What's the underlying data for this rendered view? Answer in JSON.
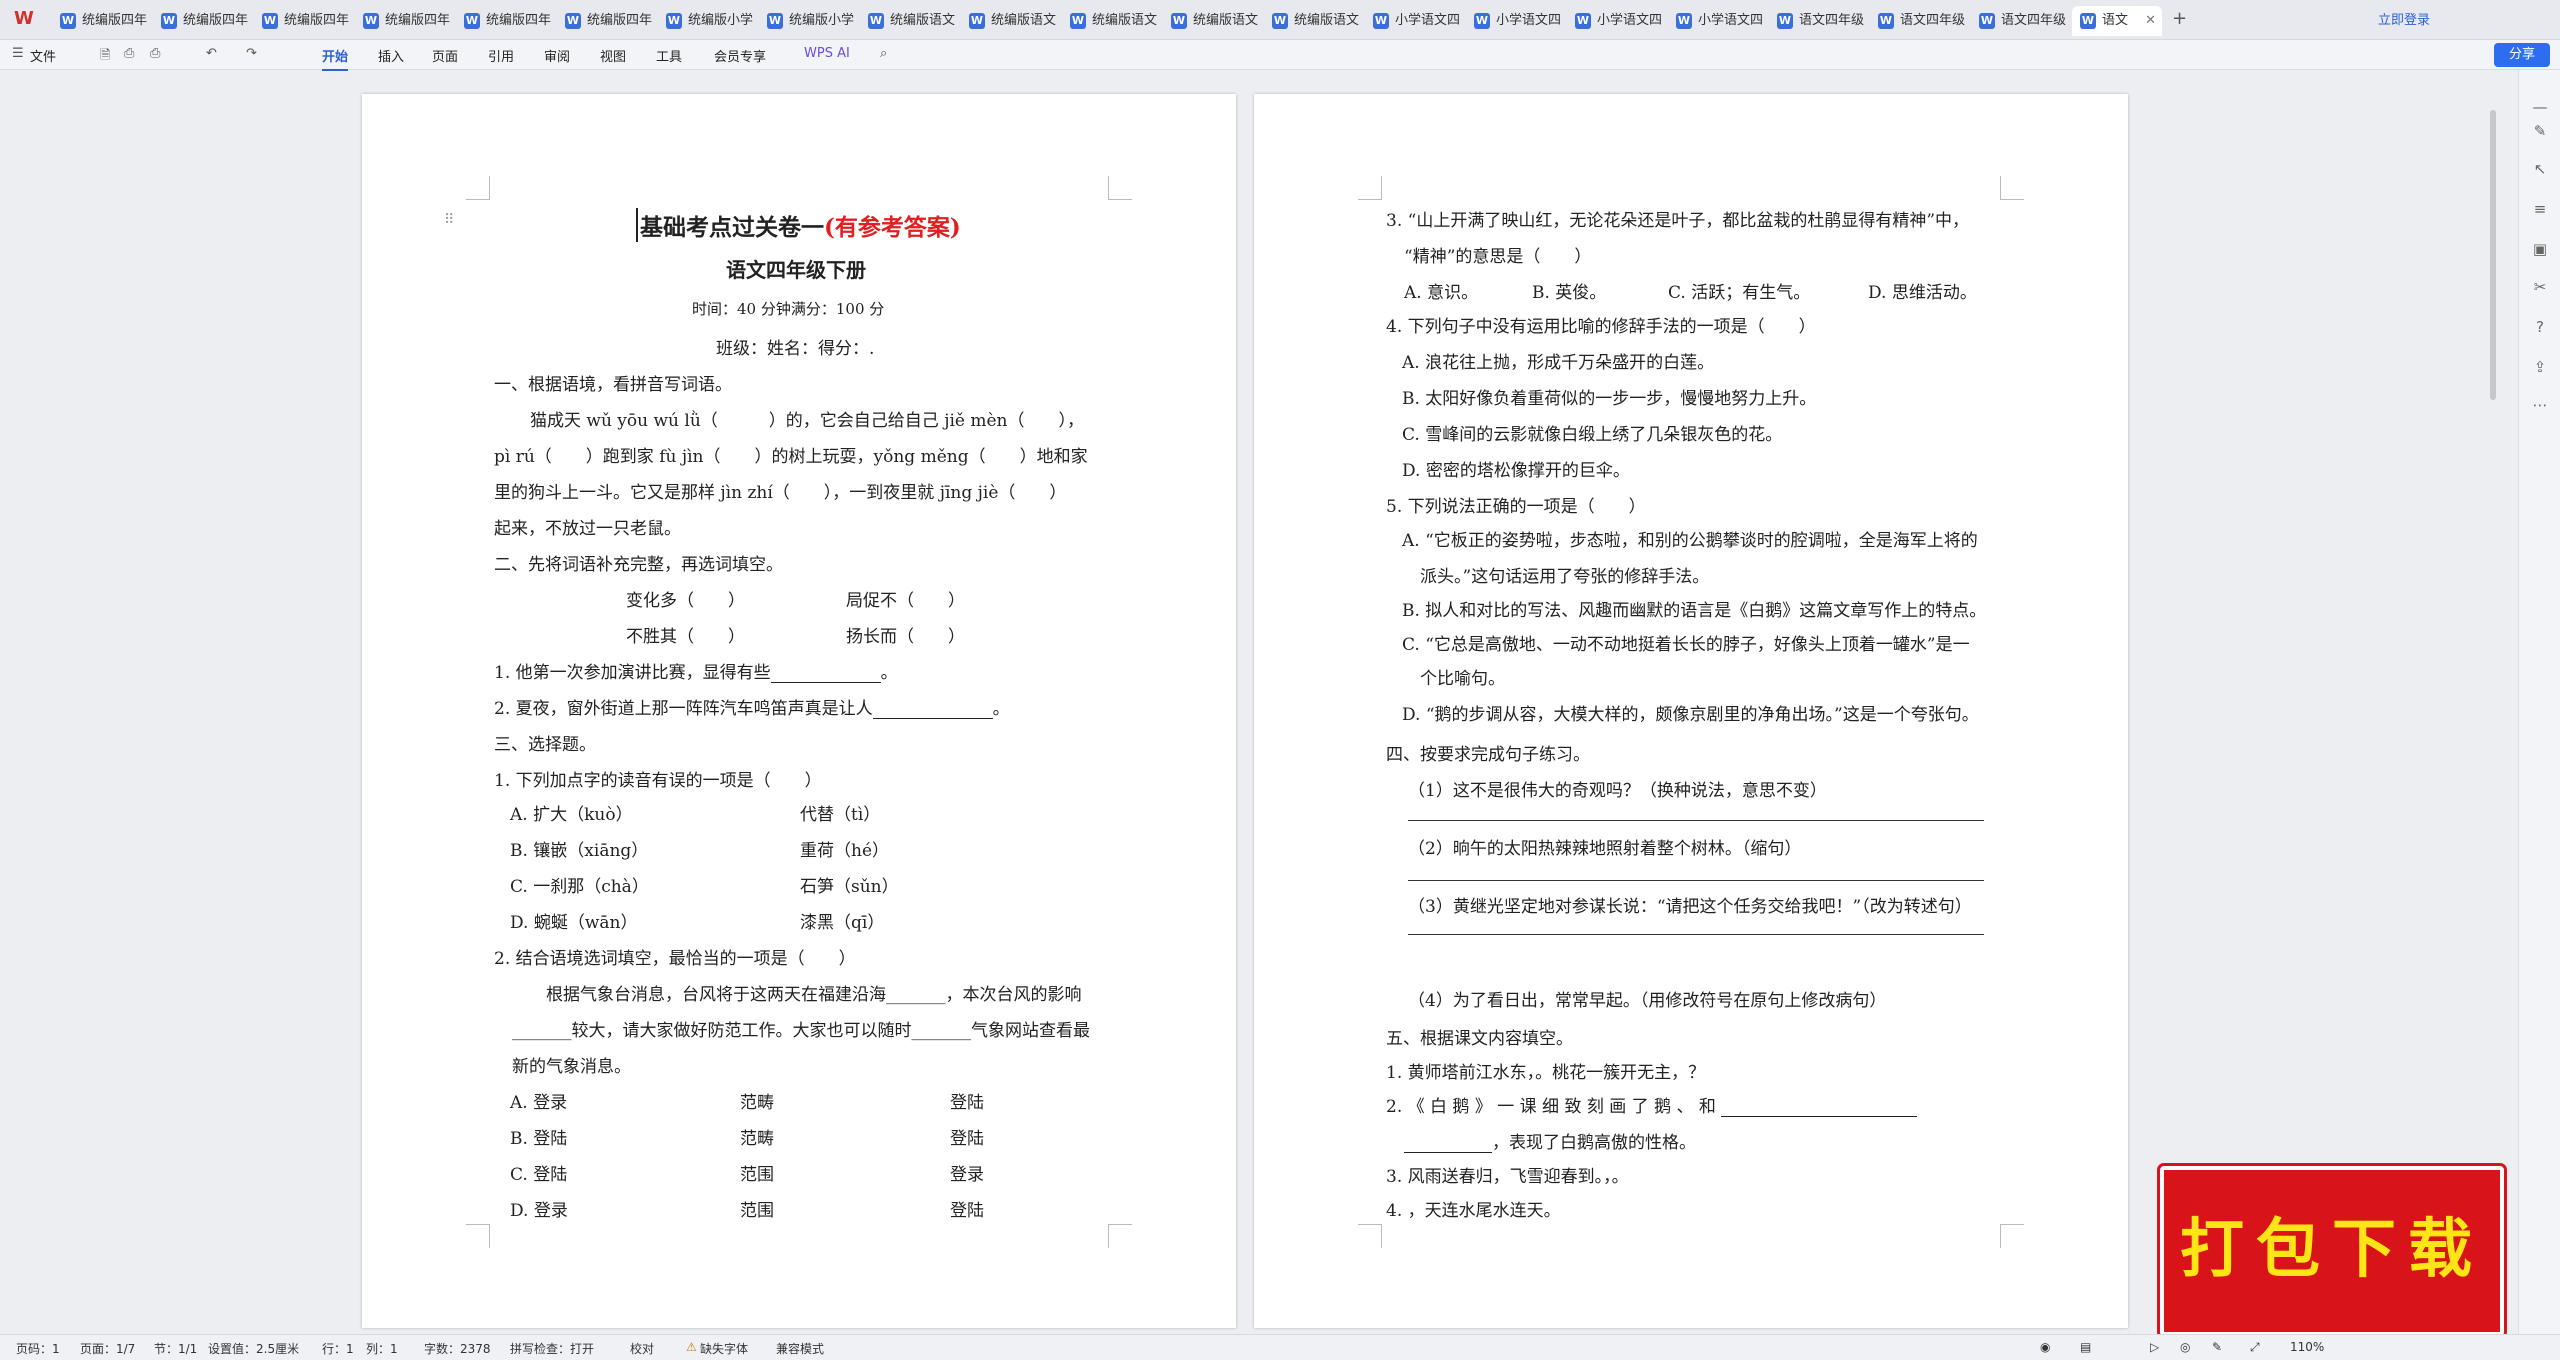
{
  "tabbar": {
    "tabs": [
      "统编版四年",
      "统编版四年",
      "统编版四年",
      "统编版四年",
      "统编版四年",
      "统编版四年",
      "统编版小学",
      "统编版小学",
      "统编版语文",
      "统编版语文",
      "统编版语文",
      "统编版语文",
      "统编版语文",
      "小学语文四",
      "小学语文四",
      "小学语文四",
      "小学语文四",
      "语文四年级",
      "语文四年级",
      "语文四年级"
    ],
    "active_tab": "语文",
    "login": "立即登录"
  },
  "toolbar": {
    "file": "文件",
    "tabs": [
      "开始",
      "插入",
      "页面",
      "引用",
      "审阅",
      "视图",
      "工具",
      "会员专享"
    ],
    "wps_ai": "WPS AI",
    "share": "分享"
  },
  "page1": {
    "title": "基础考点过关卷一",
    "title_red": "(有参考答案)",
    "subtitle": "语文四年级下册",
    "time": "时间：40 分钟满分：100 分",
    "class": "班级：姓名：得分：.",
    "s1": "一、根据语境，看拼音写词语。",
    "l1": "猫成天 wǔ yōu wú lǜ（　　　）的，它会自己给自己 jiě mèn（　　），",
    "l2": "pì rú（　　）跑到家 fù jìn（　　）的树上玩耍，yǒng měng（　　）地和家",
    "l3": "里的狗斗上一斗。它又是那样 jìn zhí（　　），一到夜里就 jīng jiè（　　）",
    "l4": "起来，不放过一只老鼠。",
    "s2": "二、先将词语补充完整，再选词填空。",
    "w1": "变化多（　　）",
    "w2": "局促不（　　）",
    "w3": "不胜其（　　）",
    "w4": "扬长而（　　）",
    "q1": "1. 他第一次参加演讲比赛，显得有些",
    "q2": "2. 夏夜，窗外街道上那一阵阵汽车鸣笛声真是让人",
    "s3": "三、选择题。",
    "c1": "1. 下列加点字的读音有误的一项是（　　）",
    "c1a": "A. 扩大（kuò）",
    "c1b": "B. 镶嵌（xiāng）",
    "c1c": "C. 一刹那（chà）",
    "c1d": "D. 蜿蜒（wān）",
    "c1e": "代替（tì）",
    "c1f": "重荷（hé）",
    "c1g": "石笋（sǔn）",
    "c1h": "漆黑（qī）",
    "c2": "2. 结合语境选词填空，最恰当的一项是（　　）",
    "c2l1": "根据气象台消息，台风将于这两天在福建沿海_______，本次台风的影响",
    "c2l2": "_______较大，请大家做好防范工作。大家也可以随时_______气象网站查看最",
    "c2l3": "新的气象消息。",
    "oA": [
      "A. 登录",
      "范畴",
      "登陆"
    ],
    "oB": [
      "B. 登陆",
      "范畴",
      "登陆"
    ],
    "oC": [
      "C. 登陆",
      "范围",
      "登录"
    ],
    "oD": [
      "D. 登录",
      "范围",
      "登陆"
    ]
  },
  "page2": {
    "q3": "3. “山上开满了映山红，无论花朵还是叶子，都比盆栽的杜鹃显得有精神”中，",
    "q3b": "“精神”的意思是（　　）",
    "q3o": [
      "A. 意识。",
      "B. 英俊。",
      "C. 活跃；有生气。",
      "D. 思维活动。"
    ],
    "q4": "4. 下列句子中没有运用比喻的修辞手法的一项是（　　）",
    "q4a": "A. 浪花往上抛，形成千万朵盛开的白莲。",
    "q4b": "B. 太阳好像负着重荷似的一步一步，慢慢地努力上升。",
    "q4c": "C. 雪峰间的云影就像白缎上绣了几朵银灰色的花。",
    "q4d": "D. 密密的塔松像撑开的巨伞。",
    "q5": "5. 下列说法正确的一项是（　　）",
    "q5a": "A. “它板正的姿势啦，步态啦，和别的公鹅攀谈时的腔调啦，全是海军上将的",
    "q5a2": "派头。”这句话运用了夸张的修辞手法。",
    "q5b": "B. 拟人和对比的写法、风趣而幽默的语言是《白鹅》这篇文章写作上的特点。",
    "q5c": "C. “它总是高傲地、一动不动地挺着长长的脖子，好像头上顶着一罐水”是一",
    "q5c2": "个比喻句。",
    "q5d": "D. “鹅的步调从容，大模大样的，颇像京剧里的净角出场。”这是一个夸张句。",
    "s4": "四、按要求完成句子练习。",
    "e1": "（1）这不是很伟大的奇观吗？（换种说法，意思不变）",
    "e2": "（2）晌午的太阳热辣辣地照射着整个树林。（缩句）",
    "e3": "（3）黄继光坚定地对参谋长说：“请把这个任务交给我吧！”（改为转述句）",
    "e4": "（4）为了看日出，常常早起。（用修改符号在原句上修改病句）",
    "s5": "五、根据课文内容填空。",
    "f1": "1. 黄师塔前江水东，。桃花一簇开无主，？",
    "f2": "2. 《 白 鹅 》 一 课 细 致 刻 画 了 鹅 、 和",
    "f2b": "，表现了白鹅高傲的性格。",
    "f3": "3. 风雨送春归，飞雪迎春到。，。",
    "f4": "4. ，天连水尾水连天。"
  },
  "statusbar": {
    "page": "页码：1",
    "pages": "页面：1/7",
    "section": "节：1/1",
    "setting": "设置值：2.5厘米",
    "row": "行：1",
    "col": "列：1",
    "words": "字数：2378",
    "spell": "拼写检查：打开",
    "proof": "校对",
    "font": "缺失字体",
    "compat": "兼容模式",
    "zoom": "110%"
  },
  "banner": "打包下载"
}
